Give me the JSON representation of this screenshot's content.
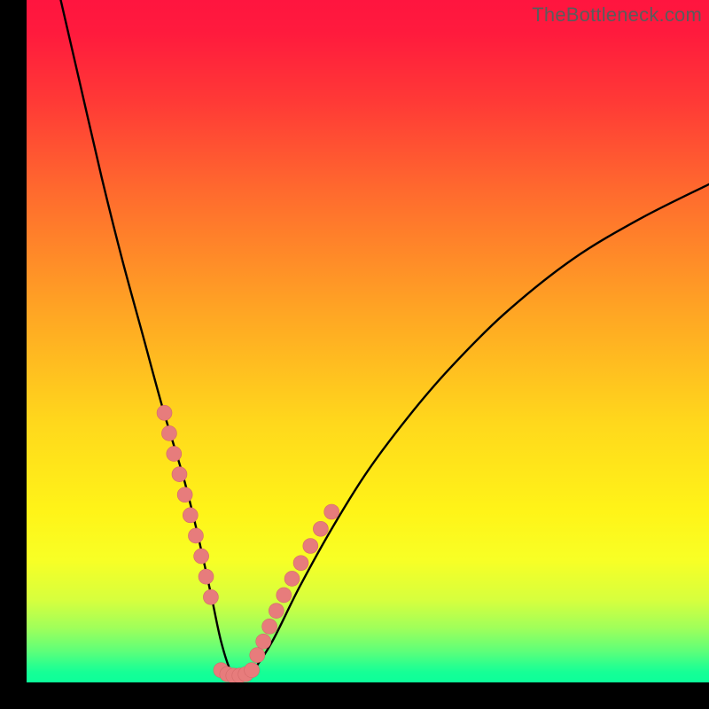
{
  "watermark": "TheBottleneck.com",
  "colors": {
    "background": "#000000",
    "curve": "#000000",
    "dot_fill": "#e77c7c",
    "dot_stroke": "#d46a6a",
    "gradient_top": "#ff153f",
    "gradient_bottom": "#0cff9a"
  },
  "chart_data": {
    "type": "line",
    "title": "",
    "xlabel": "",
    "ylabel": "",
    "xlim": [
      0,
      100
    ],
    "ylim": [
      0,
      100
    ],
    "notes": "V-shaped bottleneck curve. y ≈ 100 at x≈5, dips to y≈0 near x≈30, rises to y≈73 at x=100. Pink dots mark a band on the lower portions of both arms and along the trough.",
    "series": [
      {
        "name": "bottleneck-curve",
        "x": [
          5,
          8,
          11,
          14,
          17,
          20,
          23,
          25,
          27,
          28.5,
          30,
          31.5,
          33,
          36,
          40,
          45,
          50,
          56,
          62,
          70,
          80,
          90,
          100
        ],
        "y": [
          100,
          87,
          74,
          62,
          51,
          40,
          30,
          22,
          13,
          6,
          1.5,
          0.5,
          1.5,
          6,
          14,
          23,
          31,
          39,
          46,
          54,
          62,
          68,
          73
        ]
      },
      {
        "name": "dots-left-arm",
        "x": [
          20.2,
          20.9,
          21.6,
          22.4,
          23.2,
          24.0,
          24.8,
          25.6,
          26.3,
          27.0
        ],
        "y": [
          39.5,
          36.5,
          33.5,
          30.5,
          27.5,
          24.5,
          21.5,
          18.5,
          15.5,
          12.5
        ]
      },
      {
        "name": "dots-right-arm",
        "x": [
          33.8,
          34.7,
          35.6,
          36.6,
          37.7,
          38.9,
          40.2,
          41.6,
          43.1,
          44.7
        ],
        "y": [
          4.0,
          6.0,
          8.2,
          10.5,
          12.8,
          15.2,
          17.5,
          20.0,
          22.5,
          25.0
        ]
      },
      {
        "name": "dots-trough",
        "x": [
          28.5,
          29.4,
          30.3,
          31.2,
          32.1,
          33.0
        ],
        "y": [
          1.8,
          1.2,
          1.0,
          1.0,
          1.2,
          1.8
        ]
      }
    ]
  }
}
